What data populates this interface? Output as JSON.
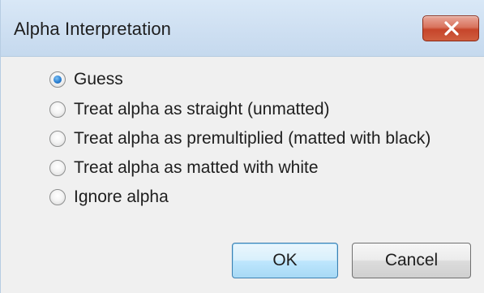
{
  "window": {
    "title": "Alpha Interpretation",
    "close_icon": "close-icon"
  },
  "options": [
    {
      "label": "Guess",
      "checked": true
    },
    {
      "label": "Treat alpha as straight (unmatted)",
      "checked": false
    },
    {
      "label": "Treat alpha as premultiplied (matted with black)",
      "checked": false
    },
    {
      "label": "Treat alpha as matted with white",
      "checked": false
    },
    {
      "label": "Ignore alpha",
      "checked": false
    }
  ],
  "buttons": {
    "ok_label": "OK",
    "cancel_label": "Cancel"
  },
  "colors": {
    "titlebar": "#cfe0f2",
    "close_button": "#c6452a",
    "selected_radio": "#2a7fd1"
  }
}
